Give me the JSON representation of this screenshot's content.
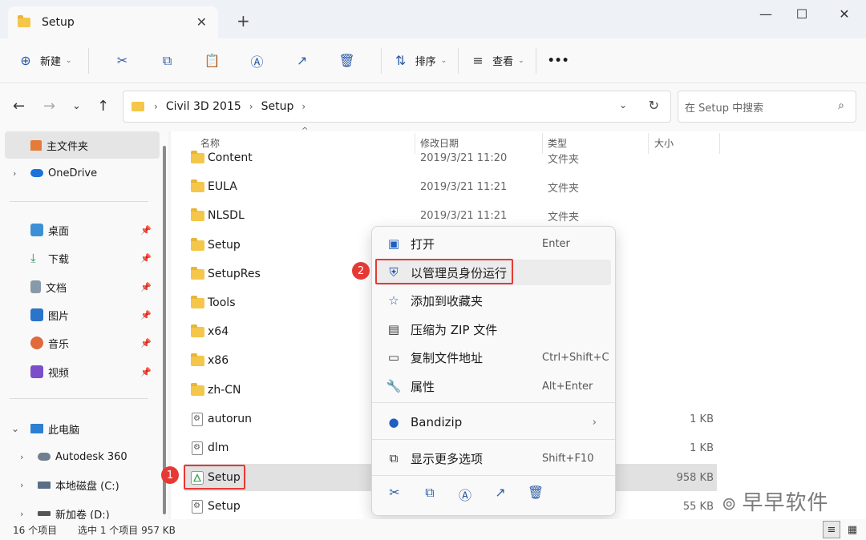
{
  "tab": {
    "title": "Setup",
    "close": "✕",
    "new_tab": "+"
  },
  "window": {
    "minimize": "—",
    "maximize": "☐",
    "close": "✕"
  },
  "toolbar": {
    "new_label": "新建",
    "sort_label": "排序",
    "view_label": "查看",
    "more": "•••"
  },
  "address": {
    "crumbs": [
      "Civil 3D 2015",
      "Setup"
    ],
    "search_placeholder": "在 Setup 中搜索"
  },
  "sidebar": {
    "home": "主文件夹",
    "onedrive": "OneDrive",
    "quick": [
      {
        "label": "桌面",
        "color": "#3d8fd6"
      },
      {
        "label": "下载",
        "color": "#2e8b57"
      },
      {
        "label": "文档",
        "color": "#8899aa"
      },
      {
        "label": "图片",
        "color": "#2a74c9"
      },
      {
        "label": "音乐",
        "color": "#e06a3b"
      },
      {
        "label": "视频",
        "color": "#7b4fc9"
      }
    ],
    "this_pc": "此电脑",
    "drives": [
      "Autodesk 360",
      "本地磁盘 (C:)",
      "新加卷 (D:)"
    ]
  },
  "columns": {
    "name": "名称",
    "date": "修改日期",
    "type": "类型",
    "size": "大小"
  },
  "files": [
    {
      "name": "Content",
      "date": "2019/3/21 11:20",
      "type": "文件夹",
      "size": "",
      "kind": "folder"
    },
    {
      "name": "EULA",
      "date": "2019/3/21 11:21",
      "type": "文件夹",
      "size": "",
      "kind": "folder"
    },
    {
      "name": "NLSDL",
      "date": "2019/3/21 11:21",
      "type": "文件夹",
      "size": "",
      "kind": "folder"
    },
    {
      "name": "Setup",
      "date": "",
      "type": "",
      "size": "",
      "kind": "folder"
    },
    {
      "name": "SetupRes",
      "date": "",
      "type": "",
      "size": "",
      "kind": "folder"
    },
    {
      "name": "Tools",
      "date": "",
      "type": "",
      "size": "",
      "kind": "folder"
    },
    {
      "name": "x64",
      "date": "",
      "type": "",
      "size": "",
      "kind": "folder"
    },
    {
      "name": "x86",
      "date": "",
      "type": "",
      "size": "",
      "kind": "folder"
    },
    {
      "name": "zh-CN",
      "date": "",
      "type": "",
      "size": "",
      "kind": "folder"
    },
    {
      "name": "autorun",
      "date": "",
      "type": "",
      "size": "1 KB",
      "kind": "file"
    },
    {
      "name": "dlm",
      "date": "",
      "type": "",
      "size": "1 KB",
      "kind": "file"
    },
    {
      "name": "Setup",
      "date": "",
      "type": "",
      "size": "958 KB",
      "kind": "setup"
    },
    {
      "name": "Setup",
      "date": "",
      "type": "",
      "size": "55 KB",
      "kind": "file"
    }
  ],
  "context_menu": {
    "items": [
      {
        "label": "打开",
        "accel": "Enter",
        "icon": "▣"
      },
      {
        "label": "以管理员身份运行",
        "accel": "",
        "icon": "⛨"
      },
      {
        "label": "添加到收藏夹",
        "accel": "",
        "icon": "☆"
      },
      {
        "label": "压缩为 ZIP 文件",
        "accel": "",
        "icon": "▤"
      },
      {
        "label": "复制文件地址",
        "accel": "Ctrl+Shift+C",
        "icon": "▭"
      },
      {
        "label": "属性",
        "accel": "Alt+Enter",
        "icon": "🔧"
      },
      {
        "label": "Bandizip",
        "accel": "",
        "icon": "●"
      },
      {
        "label": "显示更多选项",
        "accel": "Shift+F10",
        "icon": "⧉"
      }
    ],
    "bottom_icons": [
      "✂",
      "⧉",
      "Ⓐ",
      "↗",
      "🗑"
    ]
  },
  "badges": {
    "one": "1",
    "two": "2"
  },
  "status": {
    "count": "16 个项目",
    "selected": "选中 1 个项目  957 KB"
  },
  "watermark": "早早软件"
}
